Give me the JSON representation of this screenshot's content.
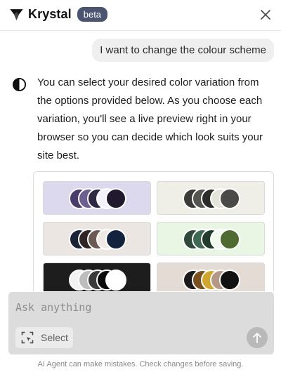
{
  "header": {
    "brand": "Krystal",
    "badge": "beta",
    "logo_icon": "krystal-logo-icon",
    "close_icon": "close-icon"
  },
  "chat": {
    "user_message": "I want to change the colour scheme",
    "assistant_icon": "half-circle-contrast-icon",
    "assistant_message": "You can select your desired color variation from the options provided below. As you choose each variation, you'll see a live preview right in your browser so you can decide which look suits your site best."
  },
  "palettes": [
    {
      "background": "#dcd9ef",
      "colors": [
        "#4a3c6a",
        "#6c6090",
        "#2e2844",
        "#f3f1fb",
        "#211a2e"
      ]
    },
    {
      "background": "#efefe8",
      "colors": [
        "#3b3b38",
        "#55554f",
        "#2b2b29",
        "#e4e4da",
        "#4a4a48"
      ]
    },
    {
      "background": "#ece6e2",
      "colors": [
        "#1a2436",
        "#2e2524",
        "#6e5a55",
        "#efe8e4",
        "#14233d"
      ]
    },
    {
      "background": "#eaf6e4",
      "colors": [
        "#2f4a3b",
        "#3e6a54",
        "#213b2c",
        "#f1f8ec",
        "#4f6b32"
      ]
    },
    {
      "background": "#1d1d1d",
      "colors": [
        "#f2f2f2",
        "#bdbdbd",
        "#3a3a3a",
        "#0a0a0a",
        "#ffffff"
      ]
    },
    {
      "background": "#e5dbd5",
      "colors": [
        "#1b1919",
        "#7a4f1f",
        "#d2a62c",
        "#b49885",
        "#111111"
      ]
    }
  ],
  "composer": {
    "placeholder": "Ask anything",
    "select_label": "Select",
    "select_icon": "select-region-icon",
    "send_icon": "arrow-up-icon"
  },
  "disclaimer": "AI Agent can make mistakes. Check changes before saving."
}
